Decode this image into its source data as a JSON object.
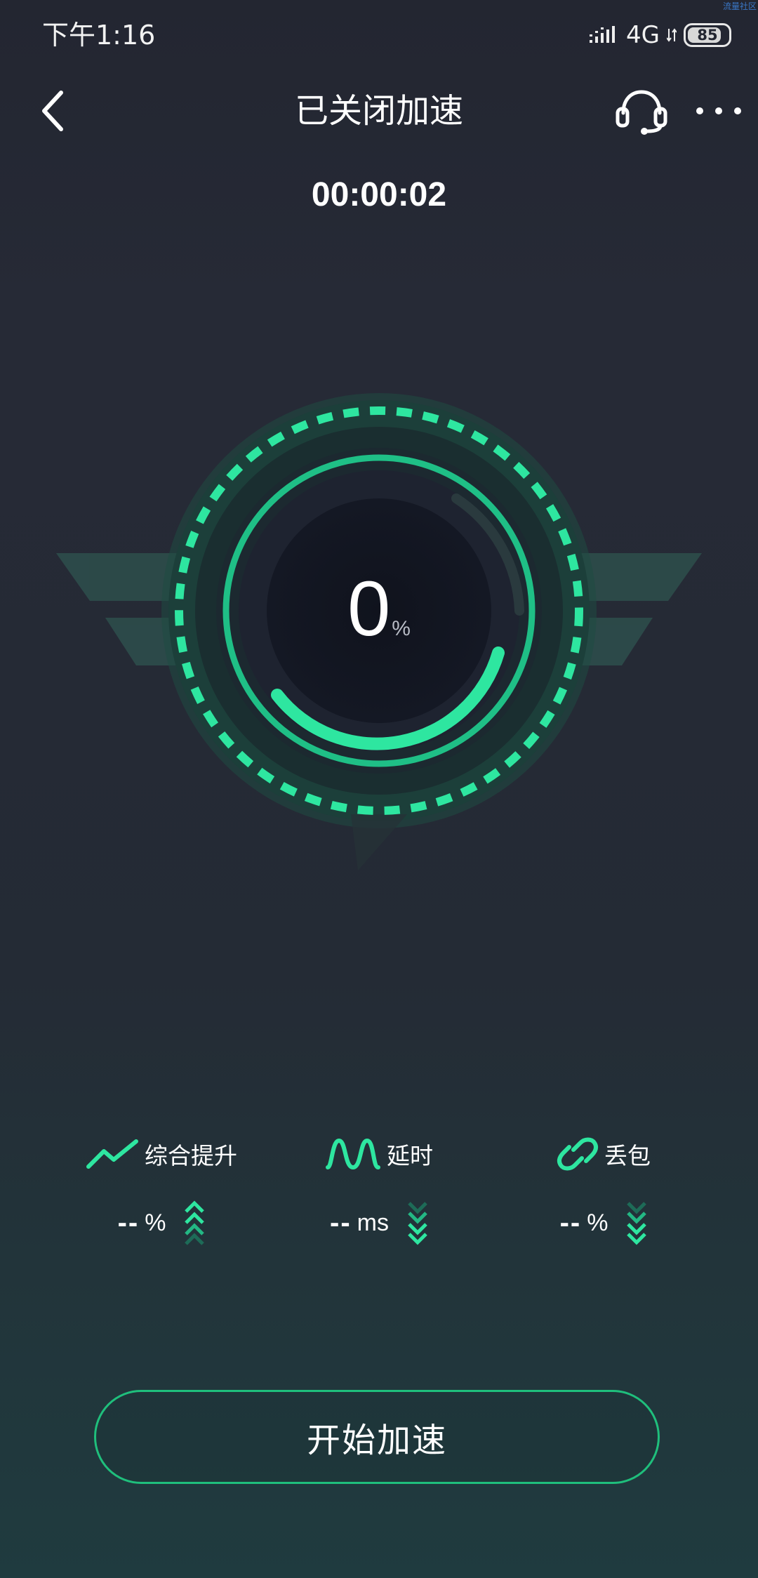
{
  "status_bar": {
    "time": "下午1:16",
    "network": "4G",
    "battery": "85",
    "battery_level": 0.85,
    "corner_text": "流量社区"
  },
  "header": {
    "title": "已关闭加速",
    "back_icon": "back-chevron-icon",
    "support_icon": "headset-icon",
    "more_icon": "more-dots-icon"
  },
  "timer": "00:00:02",
  "gauge": {
    "value": "0",
    "unit": "%",
    "accent_color": "#2ee6a0"
  },
  "stats": [
    {
      "label": "综合提升",
      "value": "--",
      "unit": "%",
      "icon": "trend-up-icon",
      "direction": "up"
    },
    {
      "label": "延时",
      "value": "--",
      "unit": "ms",
      "icon": "wave-icon",
      "direction": "down"
    },
    {
      "label": "丢包",
      "value": "--",
      "unit": "%",
      "icon": "link-icon",
      "direction": "down"
    }
  ],
  "action": {
    "start_label": "开始加速"
  },
  "colors": {
    "accent": "#2ee6a0",
    "accent_dark": "#1f9e73",
    "background": "#252a35"
  }
}
